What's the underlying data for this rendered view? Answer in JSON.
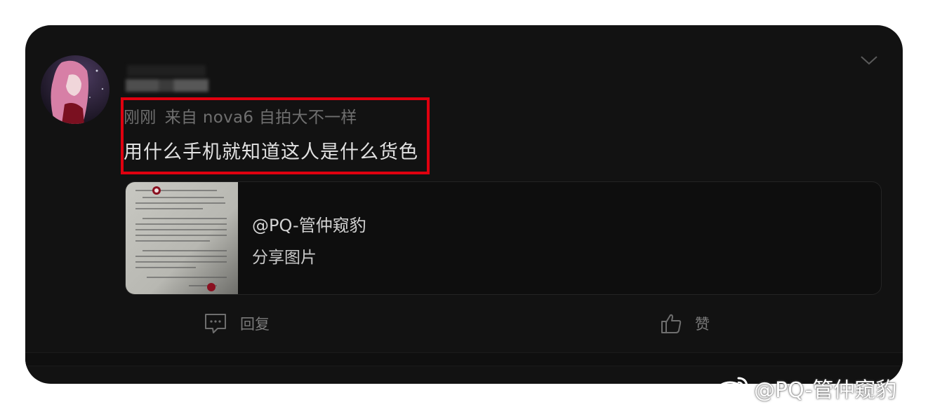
{
  "post": {
    "meta": {
      "time": "刚刚",
      "source": "来自 nova6 自拍大不一样"
    },
    "comment_text": "用什么手机就知道这人是什么货色",
    "share_card": {
      "title": "@PQ-管仲窥豹",
      "subtitle": "分享图片"
    },
    "actions": {
      "reply_label": "回复",
      "like_label": "赞"
    }
  },
  "icons": {
    "avatar": "avatar-image",
    "menu": "chevron-down-icon",
    "reply": "comment-icon",
    "like": "thumbs-up-icon",
    "watermark": "weibo-logo-icon"
  },
  "colors": {
    "highlight": "#e0000f",
    "card_bg": "#121212"
  },
  "watermark": {
    "text": "@PQ-管仲窥豹"
  }
}
